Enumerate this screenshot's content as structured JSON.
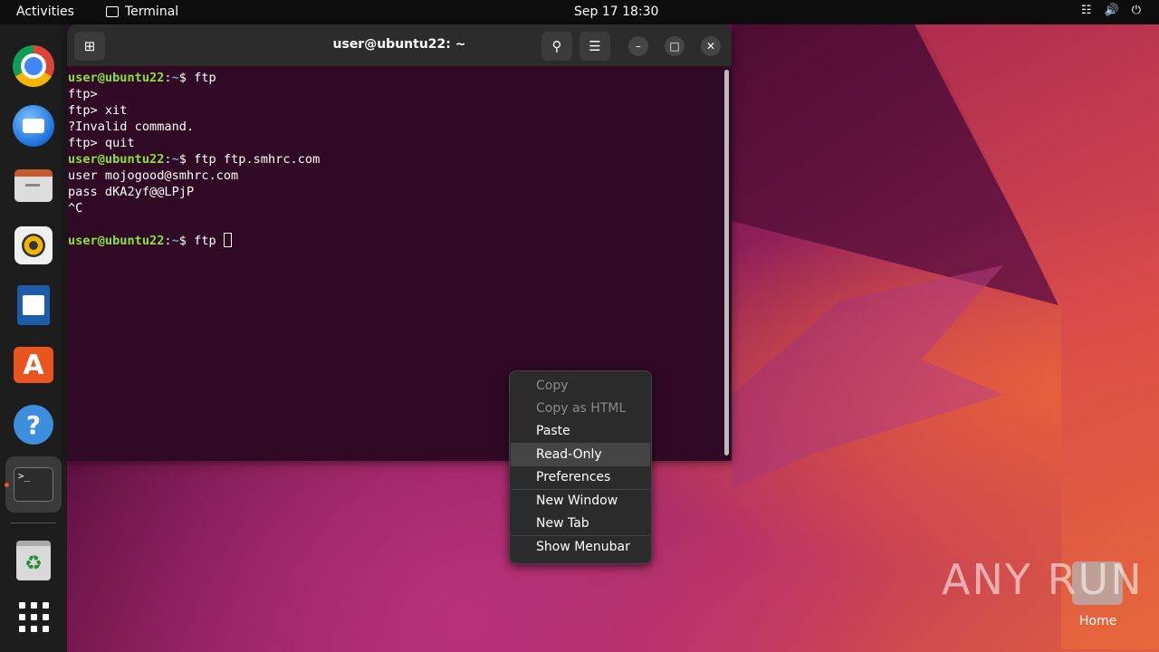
{
  "topbar": {
    "activities": "Activities",
    "app_name": "Terminal",
    "clock": "Sep 17  18:30"
  },
  "dock": {
    "items": [
      "chrome-icon",
      "thunderbird-icon",
      "files-icon",
      "rhythmbox-icon",
      "writer-icon",
      "app-center-icon",
      "help-icon",
      "terminal-icon",
      "trash-icon",
      "show-apps-icon"
    ]
  },
  "terminal": {
    "title": "user@ubuntu22: ~",
    "prompt_user": "user@ubuntu22",
    "prompt_sep": ":",
    "prompt_path": "~",
    "prompt_end": "$ ",
    "lines": [
      {
        "type": "prompt",
        "cmd": "ftp"
      },
      {
        "type": "out",
        "text": "ftp>"
      },
      {
        "type": "out",
        "text": "ftp> xit"
      },
      {
        "type": "out",
        "text": "?Invalid command."
      },
      {
        "type": "out",
        "text": "ftp> quit"
      },
      {
        "type": "prompt",
        "cmd": "ftp ftp.smhrc.com"
      },
      {
        "type": "out",
        "text": "user mojogood@smhrc.com"
      },
      {
        "type": "out",
        "text": "pass dKA2yf@@LPjP"
      },
      {
        "type": "out",
        "text": "^C"
      },
      {
        "type": "out",
        "text": ""
      },
      {
        "type": "prompt",
        "cmd": "ftp ",
        "cursor": true
      }
    ]
  },
  "context_menu": {
    "copy": "Copy",
    "copy_html": "Copy as HTML",
    "paste": "Paste",
    "read_only": "Read-Only",
    "preferences": "Preferences",
    "new_window": "New Window",
    "new_tab": "New Tab",
    "show_menubar": "Show Menubar"
  },
  "desktop": {
    "watermark": "ANY RUN",
    "home_label": "Home"
  }
}
